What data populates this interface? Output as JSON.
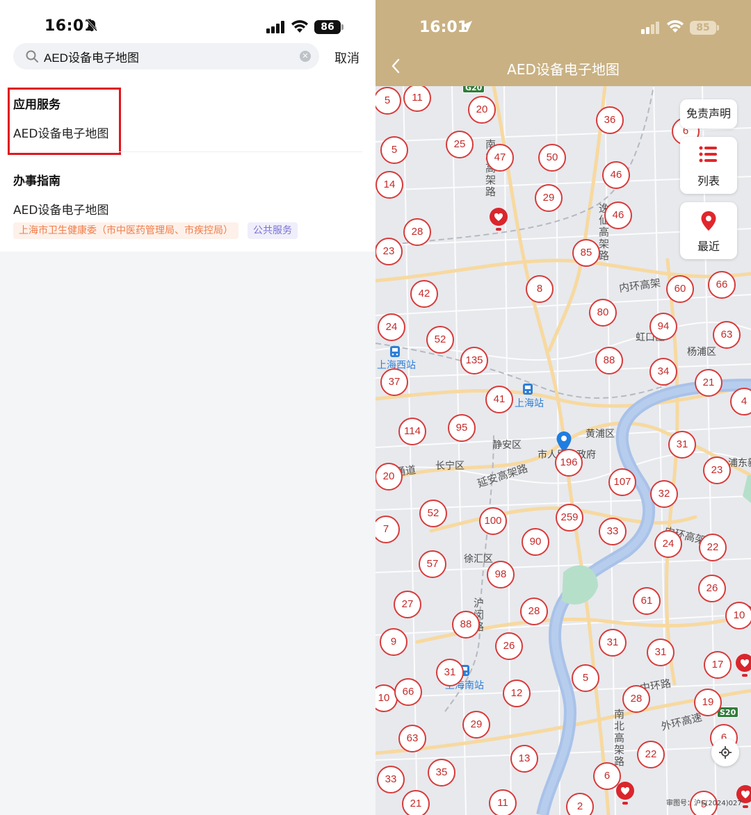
{
  "left": {
    "status": {
      "time": "16:01",
      "battery": "86"
    },
    "search": {
      "value": "AED设备电子地图",
      "cancel": "取消"
    },
    "section1": {
      "title": "应用服务",
      "item": "AED设备电子地图"
    },
    "section2": {
      "title": "办事指南",
      "item": "AED设备电子地图",
      "tags": [
        "上海市卫生健康委（市中医药管理局、市疾控局）",
        "公共服务"
      ]
    }
  },
  "right": {
    "status": {
      "time": "16:01",
      "battery": "85"
    },
    "title": "AED设备电子地图",
    "buttons": {
      "disclaimer": "免责声明",
      "list": "列表",
      "recent": "最近"
    },
    "review_no": "审图号：沪S(2024)027",
    "map_labels": [
      "上海西站",
      "上海站",
      "上海南站",
      "静安区",
      "长宁区",
      "黄浦区",
      "徐汇区",
      "虹口区",
      "杨浦区",
      "浦东新",
      "市人民市政府"
    ],
    "road_labels": [
      "内环高架",
      "延安高架路",
      "内环高架",
      "中环路",
      "外环高速",
      "逸仙高架路",
      "南北高架路",
      "沪闵路",
      "南北高架路",
      "通道"
    ],
    "road_shields": [
      "G20",
      "S20"
    ],
    "clusters": [
      "5",
      "11",
      "20",
      "36",
      "6",
      "5",
      "25",
      "47",
      "50",
      "46",
      "14",
      "29",
      "46",
      "28",
      "23",
      "85",
      "8",
      "60",
      "66",
      "42",
      "80",
      "94",
      "63",
      "24",
      "52",
      "135",
      "88",
      "34",
      "21",
      "37",
      "41",
      "4",
      "114",
      "95",
      "31",
      "196",
      "20",
      "107",
      "23",
      "32",
      "52",
      "100",
      "259",
      "33",
      "7",
      "90",
      "24",
      "22",
      "57",
      "98",
      "26",
      "27",
      "61",
      "28",
      "88",
      "10",
      "9",
      "26",
      "31",
      "31",
      "17",
      "31",
      "5",
      "28",
      "19",
      "10",
      "66",
      "12",
      "63",
      "29",
      "6",
      "13",
      "22",
      "33",
      "35",
      "6",
      "21",
      "11",
      "2",
      "5"
    ]
  },
  "colors": {
    "header": "#c9b183",
    "cluster_red": "#d83a3a",
    "highlight_red": "#e0161e",
    "tag_orange": "#f07c48",
    "tag_purple": "#7b73d6"
  }
}
